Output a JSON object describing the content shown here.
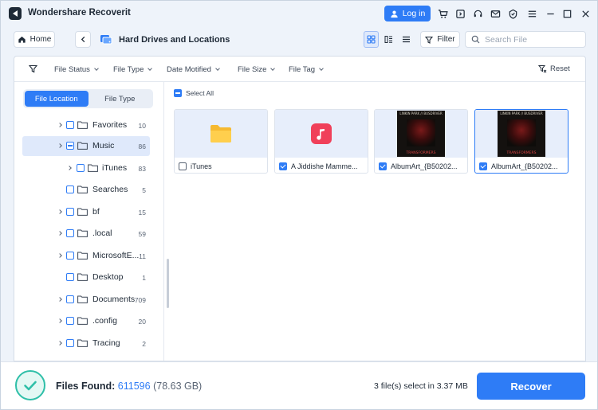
{
  "app": {
    "title": "Wondershare Recoverit"
  },
  "titlebar": {
    "login_label": "Log in",
    "icons": [
      "cart-icon",
      "export-icon",
      "headset-icon",
      "mail-icon",
      "shield-icon",
      "menu-icon",
      "minimize-icon",
      "maximize-icon",
      "close-icon"
    ]
  },
  "toolbar": {
    "home_label": "Home",
    "location_title": "Hard Drives and Locations",
    "filter_label": "Filter",
    "search_placeholder": "Search File",
    "active_view": "grid"
  },
  "filterbar": {
    "dropdowns": [
      "File Status",
      "File Type",
      "Date Motified",
      "File Size",
      "File Tag"
    ],
    "reset_label": "Reset"
  },
  "sidebar": {
    "tabs": [
      "File Location",
      "File Type"
    ],
    "active_tab": "File Location",
    "items": [
      {
        "label": "Favorites",
        "count": "10"
      },
      {
        "label": "Music",
        "count": "86"
      },
      {
        "label": "iTunes",
        "count": "83"
      },
      {
        "label": "Searches",
        "count": "5"
      },
      {
        "label": "bf",
        "count": "15"
      },
      {
        "label": ".local",
        "count": "59"
      },
      {
        "label": "MicrosoftE...",
        "count": "11"
      },
      {
        "label": "Desktop",
        "count": "1"
      },
      {
        "label": "Documents",
        "count": "709"
      },
      {
        "label": ".config",
        "count": "20"
      },
      {
        "label": "Tracing",
        "count": "2"
      }
    ]
  },
  "grid": {
    "select_all_label": "Select All",
    "items": [
      {
        "name": "iTunes",
        "kind": "folder",
        "checked": false
      },
      {
        "name": "A Jiddishe Mamme...",
        "kind": "music",
        "checked": true
      },
      {
        "name": "AlbumArt_{B50202...",
        "kind": "image",
        "checked": true
      },
      {
        "name": "AlbumArt_{B50202...",
        "kind": "image",
        "checked": true
      }
    ],
    "album_art_text": {
      "top": "LINKIN PARK // BUSDRIVER",
      "bottom": "TRANSFORMERS"
    }
  },
  "bottom": {
    "files_found_label": "Files Found:",
    "files_found_count": "611596",
    "files_found_size": "(78.63 GB)",
    "selection_info": "3 file(s) select in 3.37 MB",
    "recover_label": "Recover"
  },
  "colors": {
    "accent": "#2e7cf6",
    "success": "#2fbfa8",
    "folder": "#f6b930",
    "music": "#f0405a"
  }
}
